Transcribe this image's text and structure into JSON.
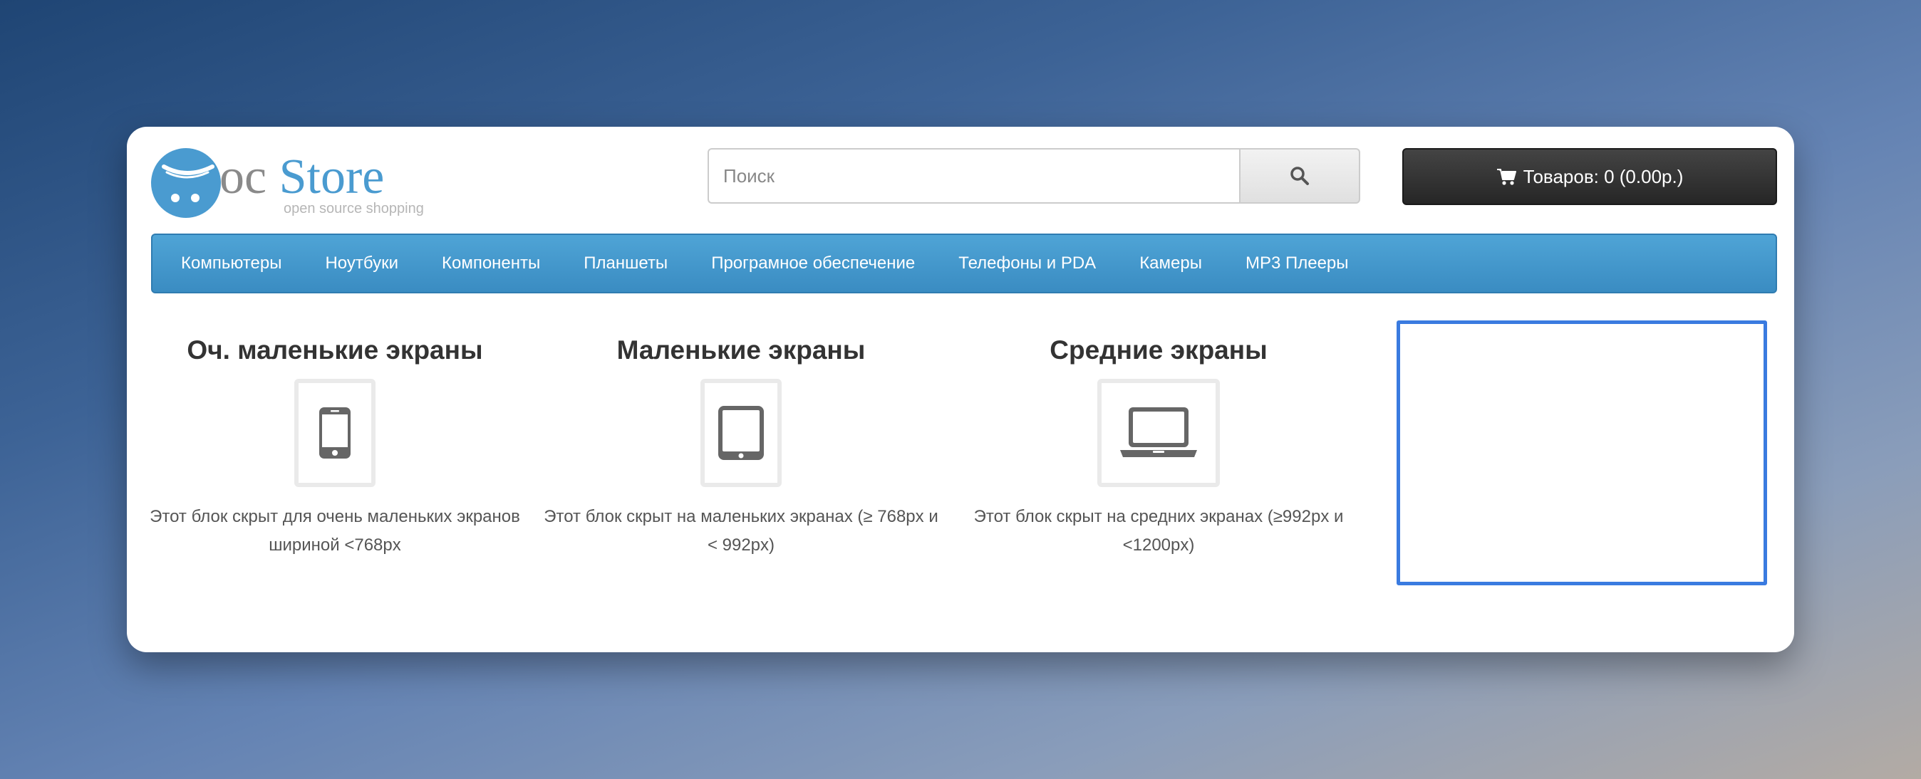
{
  "header": {
    "logo": {
      "oc": "oc",
      "store": "Store",
      "tagline": "open source shopping"
    },
    "search": {
      "placeholder": "Поиск",
      "value": ""
    },
    "cart": {
      "label": "Товаров: 0 (0.00р.)"
    }
  },
  "nav": {
    "items": [
      {
        "label": "Компьютеры"
      },
      {
        "label": "Ноутбуки"
      },
      {
        "label": "Компоненты"
      },
      {
        "label": "Планшеты"
      },
      {
        "label": "Програмное обеспечение"
      },
      {
        "label": "Телефоны и PDA"
      },
      {
        "label": "Камеры"
      },
      {
        "label": "MP3 Плееры"
      }
    ]
  },
  "blocks": [
    {
      "title": "Оч. маленькие экраны",
      "icon": "phone-icon",
      "description": "Этот блок скрыт для очень маленьких экранов шириной <768px"
    },
    {
      "title": "Маленькие экраны",
      "icon": "tablet-icon",
      "description": "Этот блок скрыт на маленьких экранах (≥ 768px и < 992px)"
    },
    {
      "title": "Средние экраны",
      "icon": "laptop-icon",
      "description": "Этот блок скрыт на средних экранах (≥992px и <1200px)"
    }
  ],
  "colors": {
    "accent": "#3a8cc2",
    "highlight": "#3a7be0",
    "cart_bg": "#2e2e2e"
  }
}
